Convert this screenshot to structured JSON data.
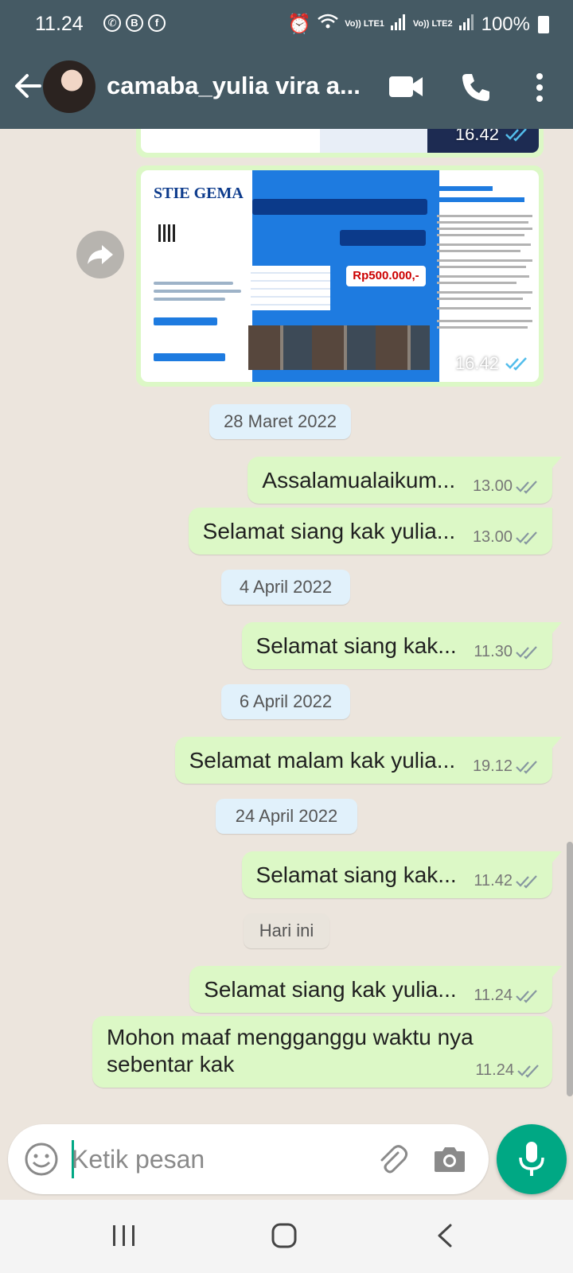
{
  "status_bar": {
    "time": "11.24",
    "network_1": "Vo)) LTE1",
    "network_2": "Vo)) LTE2",
    "battery": "100%"
  },
  "header": {
    "contact_name": "camaba_yulia vira a..."
  },
  "images": [
    {
      "time": "16.42"
    },
    {
      "time": "16.42",
      "brand": "STIE GEMA",
      "price": "Rp500.000,-"
    }
  ],
  "chat": [
    {
      "type": "date",
      "label": "28 Maret 2022"
    },
    {
      "type": "msg",
      "text": "Assalamualaikum...",
      "time": "13.00"
    },
    {
      "type": "msg",
      "text": "Selamat siang kak yulia...",
      "time": "13.00"
    },
    {
      "type": "date",
      "label": "4 April 2022"
    },
    {
      "type": "msg",
      "text": "Selamat siang kak...",
      "time": "11.30"
    },
    {
      "type": "date",
      "label": "6 April 2022"
    },
    {
      "type": "msg",
      "text": "Selamat malam kak yulia...",
      "time": "19.12"
    },
    {
      "type": "date",
      "label": "24 April 2022"
    },
    {
      "type": "msg",
      "text": "Selamat siang kak...",
      "time": "11.42"
    },
    {
      "type": "date",
      "label": "Hari ini"
    },
    {
      "type": "msg",
      "text": "Selamat siang kak yulia...",
      "time": "11.24"
    },
    {
      "type": "msg",
      "text": "Mohon maaf mengganggu waktu nya sebentar kak",
      "time": "11.24"
    }
  ],
  "input": {
    "placeholder": "Ketik pesan"
  },
  "colors": {
    "header": "#455a64",
    "outgoing_bubble": "#dcf8c6",
    "accent": "#00a884",
    "chat_background": "#ece5dd"
  }
}
